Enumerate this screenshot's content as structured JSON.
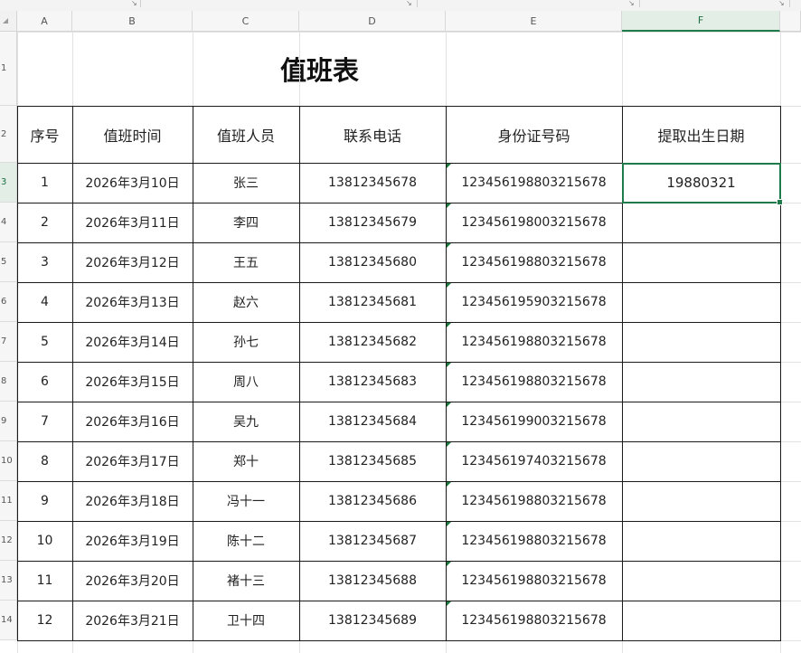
{
  "sheet": {
    "columns": [
      "A",
      "B",
      "C",
      "D",
      "E",
      "F"
    ],
    "rows": [
      "1",
      "2",
      "3",
      "4",
      "5",
      "6",
      "7",
      "8",
      "9",
      "10",
      "11",
      "12",
      "13",
      "14"
    ],
    "active_column": "F",
    "active_row": "3"
  },
  "table": {
    "title": "值班表",
    "headers": [
      "序号",
      "值班时间",
      "值班人员",
      "联系电话",
      "身份证号码",
      "提取出生日期"
    ],
    "rows": [
      [
        "1",
        "2026年3月10日",
        "张三",
        "13812345678",
        "123456198803215678",
        "19880321"
      ],
      [
        "2",
        "2026年3月11日",
        "李四",
        "13812345679",
        "123456198003215678",
        ""
      ],
      [
        "3",
        "2026年3月12日",
        "王五",
        "13812345680",
        "123456198803215678",
        ""
      ],
      [
        "4",
        "2026年3月13日",
        "赵六",
        "13812345681",
        "123456195903215678",
        ""
      ],
      [
        "5",
        "2026年3月14日",
        "孙七",
        "13812345682",
        "123456198803215678",
        ""
      ],
      [
        "6",
        "2026年3月15日",
        "周八",
        "13812345683",
        "123456198803215678",
        ""
      ],
      [
        "7",
        "2026年3月16日",
        "吴九",
        "13812345684",
        "123456199003215678",
        ""
      ],
      [
        "8",
        "2026年3月17日",
        "郑十",
        "13812345685",
        "123456197403215678",
        ""
      ],
      [
        "9",
        "2026年3月18日",
        "冯十一",
        "13812345686",
        "123456198803215678",
        ""
      ],
      [
        "10",
        "2026年3月19日",
        "陈十二",
        "13812345687",
        "123456198803215678",
        ""
      ],
      [
        "11",
        "2026年3月20日",
        "褚十三",
        "13812345688",
        "123456198803215678",
        ""
      ],
      [
        "12",
        "2026年3月21日",
        "卫十四",
        "13812345689",
        "123456198803215678",
        ""
      ]
    ]
  },
  "colors": {
    "accent": "#1f7a4c",
    "error_indicator": "#1d7a3e",
    "border": "#1a1a1a"
  },
  "icons": [
    "ribbon-launcher-icon",
    "select-all-icon",
    "error-indicator-icon"
  ]
}
